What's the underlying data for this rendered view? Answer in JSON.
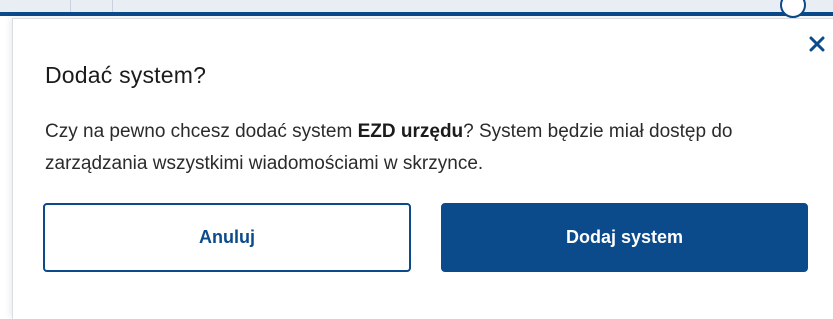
{
  "dialog": {
    "title": "Dodać system?",
    "message_prefix": "Czy na pewno chcesz dodać system ",
    "system_name": "EZD urzędu",
    "message_suffix": "? System będzie miał dostęp do zarządzania wszystkimi wiadomościami w skrzynce.",
    "close_icon": "close-icon",
    "cancel_label": "Anuluj",
    "confirm_label": "Dodaj system"
  },
  "colors": {
    "primary": "#0b4a8b",
    "text": "#2b2b2b",
    "background": "#ffffff"
  }
}
